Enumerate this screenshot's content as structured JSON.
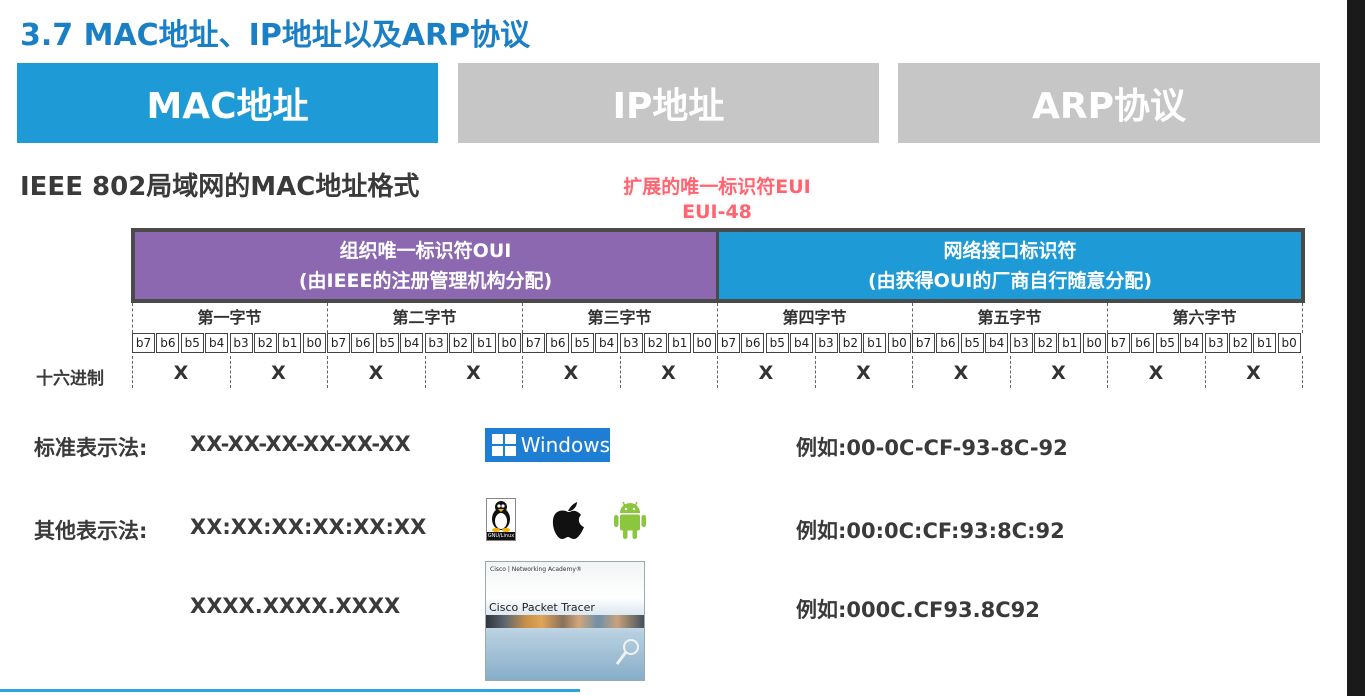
{
  "title": "3.7 MAC地址、IP地址以及ARP协议",
  "tabs": [
    {
      "label": "MAC地址",
      "active": true
    },
    {
      "label": "IP地址",
      "active": false
    },
    {
      "label": "ARP协议",
      "active": false
    }
  ],
  "section_heading": "IEEE 802局域网的MAC地址格式",
  "eui": {
    "line1": "扩展的唯一标识符EUI",
    "line2": "EUI-48"
  },
  "oui": {
    "title": "组织唯一标识符OUI",
    "subtitle": "(由IEEE的注册管理机构分配)"
  },
  "nic": {
    "title": "网络接口标识符",
    "subtitle": "(由获得OUI的厂商自行随意分配)"
  },
  "bytes": [
    "第一字节",
    "第二字节",
    "第三字节",
    "第四字节",
    "第五字节",
    "第六字节"
  ],
  "bits": [
    "b7",
    "b6",
    "b5",
    "b4",
    "b3",
    "b2",
    "b1",
    "b0"
  ],
  "hex_label": "十六进制",
  "hex_placeholder": "X",
  "notations": [
    {
      "label": "标准表示法:",
      "format": "XX-XX-XX-XX-XX-XX",
      "example": "例如:00-0C-CF-93-8C-92"
    },
    {
      "label": "其他表示法:",
      "format": "XX:XX:XX:XX:XX:XX",
      "example": "例如:00:0C:CF:93:8C:92"
    },
    {
      "label": "",
      "format": "XXXX.XXXX.XXXX",
      "example": "例如:000C.CF93.8C92"
    }
  ],
  "logos": {
    "windows": "Windows",
    "linux": "GNU/Linux",
    "cisco_academy": "Cisco | Networking Academy®",
    "cisco_product": "Cisco Packet Tracer"
  },
  "colors": {
    "title_blue": "#1a7fc4",
    "tab_active": "#1e9ad6",
    "tab_inactive": "#c6c6c6",
    "oui_purple": "#8b68b0",
    "nic_blue": "#1e9ad6",
    "eui_pink": "#ff6470"
  },
  "icons": [
    "windows-logo",
    "linux-tux-icon",
    "apple-icon",
    "android-icon",
    "cisco-packet-tracer-cover"
  ]
}
